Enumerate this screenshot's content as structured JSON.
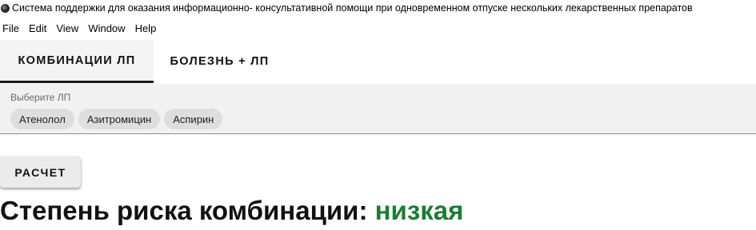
{
  "window": {
    "title": "Система поддержки для оказания информационно- консультативной помощи при  одновременном отпуске нескольких лекарственных препаратов",
    "app_icon": "app-icon"
  },
  "menu": {
    "items": [
      "File",
      "Edit",
      "View",
      "Window",
      "Help"
    ]
  },
  "tabs": [
    {
      "label": "КОМБИНАЦИИ ЛП",
      "active": true
    },
    {
      "label": "БОЛЕЗНЬ + ЛП",
      "active": false
    }
  ],
  "drug_select": {
    "label": "Выберите ЛП",
    "chips": [
      "Атенолол",
      "Азитромицин",
      "Аспирин"
    ]
  },
  "calc_button": {
    "label": "РАСЧЕТ"
  },
  "result": {
    "prefix": "Степень риска комбинации: ",
    "level": "низкая",
    "level_color": "#1e7b34"
  }
}
